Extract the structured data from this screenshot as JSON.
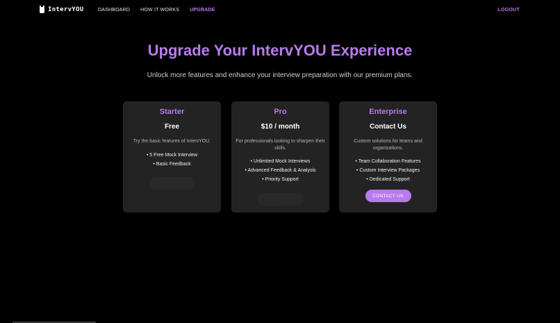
{
  "nav": {
    "brand": "IntervYOU",
    "links": [
      {
        "label": "DASHBOARD"
      },
      {
        "label": "HOW IT WORKS"
      },
      {
        "label": "UPGRADE"
      }
    ],
    "logout": "LOGOUT"
  },
  "hero": {
    "title": "Upgrade Your IntervYOU Experience",
    "subtitle": "Unlock more features and enhance your interview preparation with our premium plans."
  },
  "plans": [
    {
      "name": "Starter",
      "price": "Free",
      "description": "Try the basic features of IntervYOU.",
      "features": [
        "• 5 Free Mock Interview",
        "• Basic Feedback"
      ],
      "button": "CURRENT PLAN"
    },
    {
      "name": "Pro",
      "price": "$10 / month",
      "description": "For professionals looking to sharpen their skills.",
      "features": [
        "• Unlimited Mock Interviews",
        "• Advanced Feedback & Analysis",
        "• Priority Support"
      ],
      "button": "COMING SOON"
    },
    {
      "name": "Enterprise",
      "price": "Contact Us",
      "description": "Custom solutions for teams and organizations.",
      "features": [
        "• Team Collaboration Features",
        "• Custom Interview Packages",
        "• Dedicated Support"
      ],
      "button": "CONTACT US"
    }
  ],
  "colors": {
    "accent": "#b77bec",
    "background": "#000000",
    "card": "#232323"
  }
}
